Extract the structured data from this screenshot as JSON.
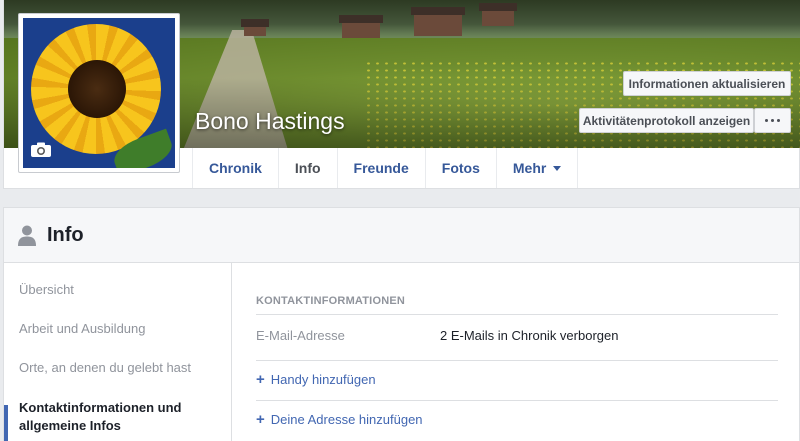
{
  "profile": {
    "name": "Bono Hastings"
  },
  "actions": {
    "update_info": "Informationen aktualisieren",
    "activity_log": "Aktivitätenprotokoll anzeigen"
  },
  "tabs": [
    {
      "label": "Chronik",
      "active": false
    },
    {
      "label": "Info",
      "active": true
    },
    {
      "label": "Freunde",
      "active": false
    },
    {
      "label": "Fotos",
      "active": false
    },
    {
      "label": "Mehr",
      "active": false
    }
  ],
  "info": {
    "title": "Info",
    "sidebar": [
      {
        "label": "Übersicht",
        "active": false
      },
      {
        "label": "Arbeit und Ausbildung",
        "active": false
      },
      {
        "label": "Orte, an denen du gelebt hast",
        "active": false
      },
      {
        "label": "Kontaktinformationen und allgemeine Infos",
        "active": true
      }
    ],
    "contact": {
      "section_title": "KONTAKTINFORMATIONEN",
      "email_label": "E-Mail-Adresse",
      "email_value": "2 E-Mails in Chronik verborgen",
      "add_phone": "Handy hinzufügen",
      "add_address": "Deine Adresse hinzufügen"
    }
  },
  "icons": {
    "camera": "camera-icon",
    "more": "dots-icon",
    "dropdown": "caret-icon",
    "info": "person-icon",
    "add": "plus-icon"
  },
  "colors": {
    "link": "#365899",
    "accent": "#4267b2",
    "muted": "#90949c",
    "text": "#1d2129"
  }
}
